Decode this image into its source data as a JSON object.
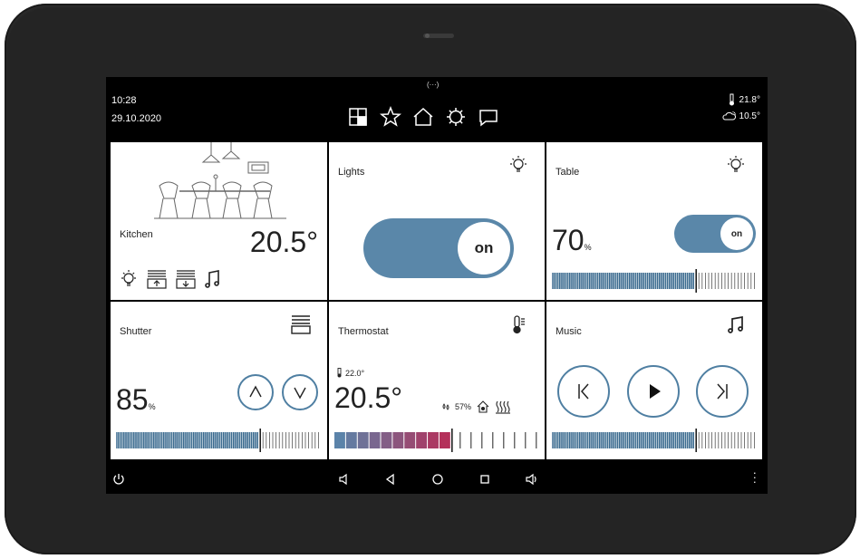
{
  "status_bar": {
    "notch": "(···)",
    "time": "10:28",
    "date": "29.10.2020",
    "nav_icons": [
      "tiles-icon",
      "star-icon",
      "home-icon",
      "gear-icon",
      "message-icon"
    ],
    "weather": {
      "indoor_temp": "21.8°",
      "outdoor_temp": "10.5°"
    }
  },
  "tiles": {
    "kitchen": {
      "label": "Kitchen",
      "temperature": "20.5°",
      "icons": [
        "bulb-icon",
        "shutter-up-icon",
        "shutter-down-icon",
        "music-note-icon"
      ]
    },
    "lights": {
      "label": "Lights",
      "toggle": "on"
    },
    "table": {
      "label": "Table",
      "toggle": "on",
      "level": "70",
      "level_unit": "%",
      "level_fraction": 0.7
    },
    "shutter": {
      "label": "Shutter",
      "level": "85",
      "level_unit": "%",
      "level_fraction": 0.7
    },
    "thermostat": {
      "label": "Thermostat",
      "setpoint": "22.0°",
      "current": "20.5°",
      "humidity": "57%",
      "level_fraction": 0.57
    },
    "music": {
      "label": "Music",
      "progress_fraction": 0.7
    }
  },
  "colors": {
    "accent": "#5a87a9",
    "bar_blue": "#3b6b8f",
    "heat_start": "#5b83a9",
    "heat_end": "#b4305a"
  }
}
